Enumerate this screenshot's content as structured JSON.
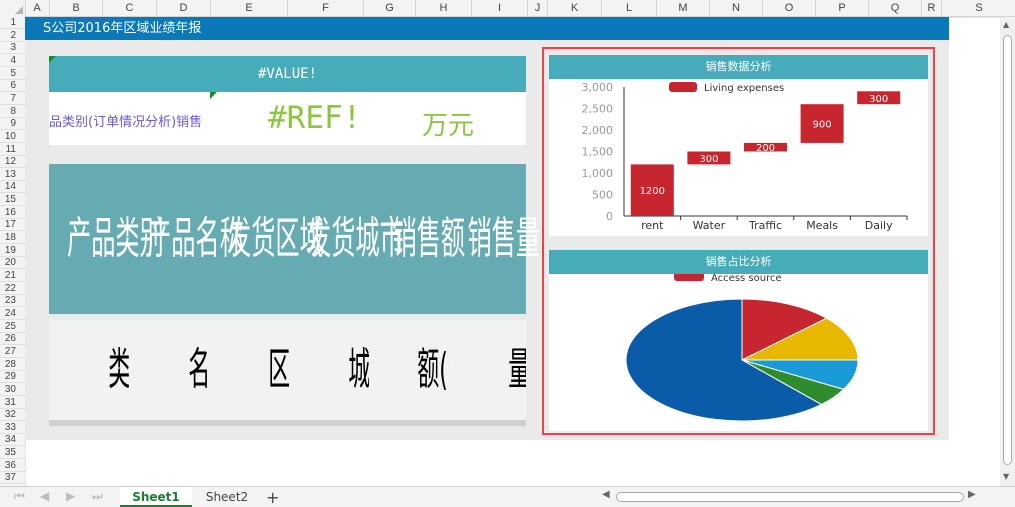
{
  "columns": [
    "A",
    "B",
    "C",
    "D",
    "E",
    "F",
    "G",
    "H",
    "I",
    "J",
    "K",
    "L",
    "M",
    "N",
    "O",
    "P",
    "Q",
    "R",
    "S"
  ],
  "rows": [
    "1",
    "2",
    "3",
    "4",
    "5",
    "6",
    "7",
    "8",
    "9",
    "10",
    "11",
    "12",
    "13",
    "14",
    "15",
    "16",
    "17",
    "18",
    "19",
    "20",
    "21",
    "22",
    "23",
    "24",
    "25",
    "26",
    "27",
    "28",
    "29",
    "30",
    "31",
    "32",
    "33",
    "34",
    "35",
    "36",
    "37"
  ],
  "report": {
    "title": "S公司2016年区域业绩年报",
    "value_error": "#VALUE!",
    "category_label": "品类别(订单情况分析)销售",
    "ref_error": "#REF!",
    "unit": "万元",
    "headers": [
      "产品类别",
      "产品名称",
      "发货区域",
      "发货城市",
      "销售额",
      "销售量"
    ],
    "data_cells": [
      "类别(订单情",
      "名称(订单情",
      "区域(订单情",
      "城市(订单情",
      "额(订单情",
      "量(订单情况"
    ]
  },
  "charts": {
    "waterfall_title": "销售数据分析",
    "pie_title": "销售占比分析"
  },
  "chart_data": [
    {
      "type": "bar",
      "title": "销售数据分析",
      "legend": "Living expenses",
      "legend_position": "top",
      "categories": [
        "rent",
        "Water",
        "Traffic",
        "Meals",
        "Daily"
      ],
      "series": [
        {
          "name": "Living expenses",
          "base": [
            0,
            1200,
            1500,
            1700,
            2600
          ],
          "values": [
            1200,
            300,
            200,
            900,
            300
          ]
        }
      ],
      "labels": [
        "1200",
        "300",
        "200",
        "900",
        "300"
      ],
      "ylim": [
        0,
        3000
      ],
      "yticks": [
        "0",
        "500",
        "1,000",
        "1,500",
        "2,000",
        "2,500",
        "3,000"
      ],
      "grid": false,
      "color": "#c8262e"
    },
    {
      "type": "pie",
      "title": "销售占比分析",
      "legend": "Access source",
      "legend_position": "top",
      "slices": [
        {
          "value": 13,
          "color": "#c8262e"
        },
        {
          "value": 12,
          "color": "#e8b800"
        },
        {
          "value": 8,
          "color": "#1a9ad6"
        },
        {
          "value": 5,
          "color": "#2e8b2e"
        },
        {
          "value": 62,
          "color": "#0b5ca8"
        }
      ]
    }
  ],
  "sheets": {
    "tabs": [
      "Sheet1",
      "Sheet2"
    ],
    "active": "Sheet1"
  }
}
